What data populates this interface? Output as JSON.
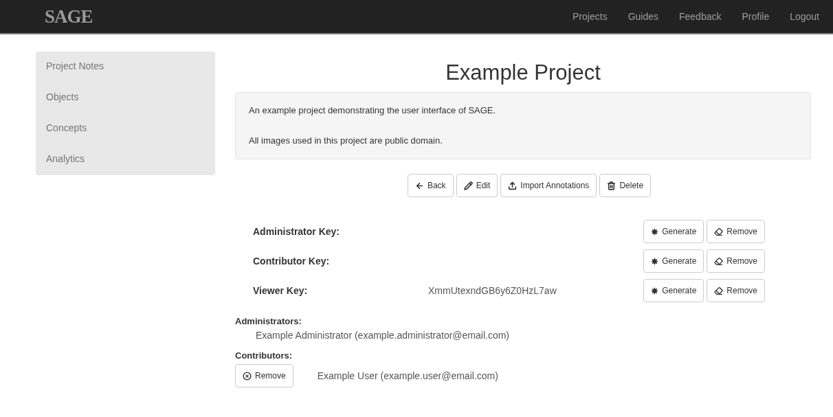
{
  "navbar": {
    "brand": "SAGE",
    "links": [
      "Projects",
      "Guides",
      "Feedback",
      "Profile",
      "Logout"
    ]
  },
  "sidebar": {
    "items": [
      {
        "label": "Project Notes"
      },
      {
        "label": "Objects"
      },
      {
        "label": "Concepts"
      },
      {
        "label": "Analytics"
      }
    ]
  },
  "project": {
    "title": "Example Project",
    "description": [
      "An example project demonstrating the user interface of SAGE.",
      "All images used in this project are public domain."
    ]
  },
  "actions": [
    {
      "kind": "back",
      "label": "Back"
    },
    {
      "kind": "edit",
      "label": "Edit"
    },
    {
      "kind": "import",
      "label": "Import Annotations"
    },
    {
      "kind": "delete",
      "label": "Delete"
    }
  ],
  "keys": [
    {
      "label": "Administrator Key:",
      "generate": "Generate",
      "remove": "Remove"
    },
    {
      "label": "Contributor Key:",
      "generate": "Generate",
      "remove": "Remove"
    },
    {
      "label": "Viewer Key:",
      "value": "XmmUtexndGB6y6Z0HzL7aw",
      "generate": "Generate",
      "remove": "Remove"
    }
  ],
  "administrators": {
    "heading": "Administrators:",
    "members": [
      "Example Administrator (example.administrator@email.com)"
    ]
  },
  "contributors": {
    "heading": "Contributors:",
    "members": [
      {
        "remove": "Remove",
        "name": "Example User (example.user@email.com)"
      }
    ]
  }
}
